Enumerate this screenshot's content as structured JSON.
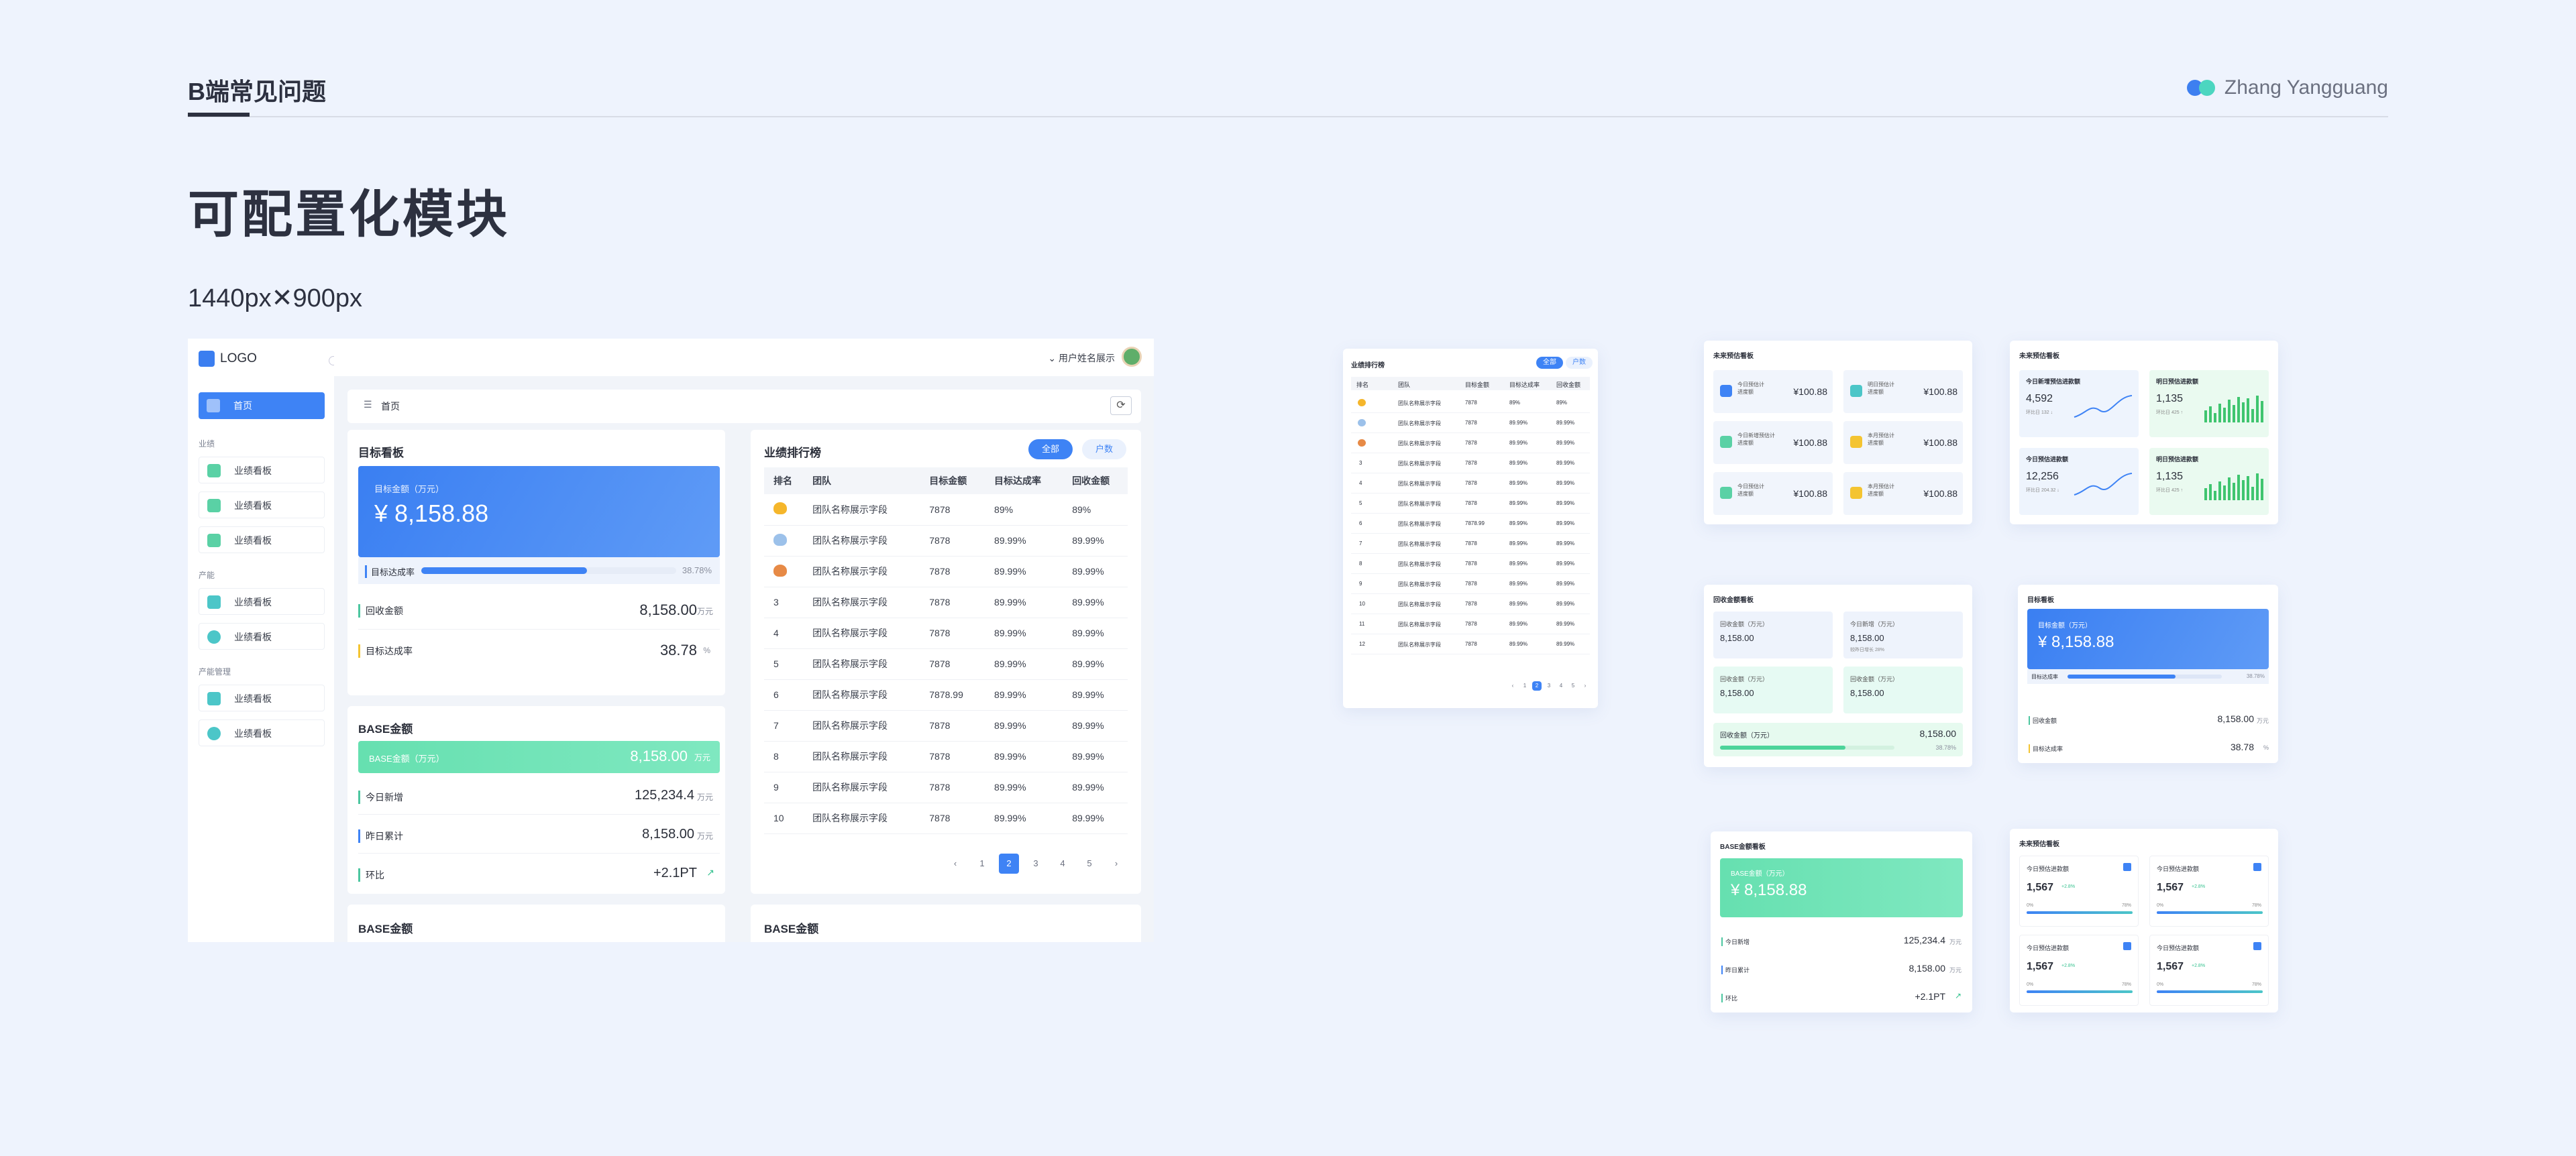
{
  "header": {
    "section": "B端常见问题",
    "author": "Zhang Yangguang",
    "colors": {
      "dot1": "#3d7ff0",
      "dot2": "#4cd6c0"
    }
  },
  "title": "可配置化模块",
  "size_label": "1440px✕900px",
  "mock": {
    "logo": "LOGO",
    "user": "用户姓名展示",
    "breadcrumb": "首页",
    "sidebar": {
      "home": "首页",
      "groups": [
        "业绩",
        "产能",
        "产能管理"
      ],
      "item": "业绩看板"
    },
    "target": {
      "title": "目标看板",
      "card_label": "目标金额（万元）",
      "card_value": "¥ 8,158.88",
      "progress_label": "目标达成率",
      "progress_pct": "38.78%",
      "progress": 0.3878,
      "rows": [
        {
          "label": "回收金额",
          "value": "8,158.00",
          "unit": "万元"
        },
        {
          "label": "目标达成率",
          "value": "38.78",
          "unit": "%"
        }
      ]
    },
    "base": {
      "title": "BASE金额",
      "card_label": "BASE金额（万元）",
      "card_value": "8,158.00",
      "card_unit": "万元",
      "rows": [
        {
          "label": "今日新增",
          "value": "125,234.4",
          "unit": "万元"
        },
        {
          "label": "昨日累计",
          "value": "8,158.00",
          "unit": "万元"
        },
        {
          "label": "环比",
          "value": "+2.1PT",
          "unit": ""
        }
      ]
    },
    "rank": {
      "title": "业绩排行榜",
      "tab_all": "全部",
      "tab_user": "户数",
      "columns": [
        "排名",
        "团队",
        "目标金额",
        "目标达成率",
        "回收金额"
      ],
      "rows": [
        [
          "",
          "团队名称展示字段",
          "7878",
          "89%",
          "89%"
        ],
        [
          "",
          "团队名称展示字段",
          "7878",
          "89.99%",
          "89.99%"
        ],
        [
          "",
          "团队名称展示字段",
          "7878",
          "89.99%",
          "89.99%"
        ],
        [
          "3",
          "团队名称展示字段",
          "7878",
          "89.99%",
          "89.99%"
        ],
        [
          "4",
          "团队名称展示字段",
          "7878",
          "89.99%",
          "89.99%"
        ],
        [
          "5",
          "团队名称展示字段",
          "7878",
          "89.99%",
          "89.99%"
        ],
        [
          "6",
          "团队名称展示字段",
          "7878.99",
          "89.99%",
          "89.99%"
        ],
        [
          "7",
          "团队名称展示字段",
          "7878",
          "89.99%",
          "89.99%"
        ],
        [
          "8",
          "团队名称展示字段",
          "7878",
          "89.99%",
          "89.99%"
        ],
        [
          "9",
          "团队名称展示字段",
          "7878",
          "89.99%",
          "89.99%"
        ],
        [
          "10",
          "团队名称展示字段",
          "7878",
          "89.99%",
          "89.99%"
        ]
      ],
      "pages": [
        "‹",
        "1",
        "2",
        "3",
        "4",
        "5",
        "›"
      ],
      "current": "2"
    },
    "bottom_left": "BASE金额",
    "bottom_right": "BASE金额"
  },
  "thumbs": {
    "rank_small": {
      "title": "业绩排行榜",
      "tab_all": "全部",
      "tab_user": "户数",
      "columns": [
        "排名",
        "团队",
        "目标金额",
        "目标达成率",
        "回收金额"
      ],
      "row_team": "团队名称展示字段",
      "pages": [
        "‹",
        "1",
        "2",
        "3",
        "4",
        "5",
        "›"
      ]
    },
    "forecast1": {
      "title": "未来预估看板",
      "items": [
        {
          "label": "今日预估计\n进度额",
          "value": "¥100.88"
        },
        {
          "label": "明日预估计\n进度额",
          "value": "¥100.88"
        },
        {
          "label": "今日新增预估计\n进度额",
          "value": "¥100.88"
        },
        {
          "label": "本月预估计\n进度额",
          "value": "¥100.88"
        },
        {
          "label": "今日预估计\n进度额",
          "value": "¥100.88"
        },
        {
          "label": "本月预估计\n进度额",
          "value": "¥100.88"
        }
      ]
    },
    "forecast2": {
      "title": "未来预估看板",
      "items": [
        {
          "label": "今日新增预估进款额",
          "value": "4,592",
          "sub": "环比日 132 ↓"
        },
        {
          "label": "明日预估进款额",
          "value": "1,135",
          "sub": "环比日 425 ↑"
        },
        {
          "label": "今日预估进款额",
          "value": "12,256",
          "sub": "环比日 204.32 ↓"
        },
        {
          "label": "明日预估进款额",
          "value": "1,135",
          "sub": "环比日 425 ↑"
        }
      ]
    },
    "recovery": {
      "title": "回收金额看板",
      "items": [
        {
          "label": "回收金额（万元）",
          "value": "8,158.00"
        },
        {
          "label": "今日新增（万元）",
          "value": "8,158.00",
          "sub": "较昨日增长 28%"
        },
        {
          "label": "回收金额（万元）",
          "value": "8,158.00"
        },
        {
          "label": "回收金额（万元）",
          "value": "8,158.00"
        }
      ],
      "bar_label": "回收金额（万元）",
      "bar_value": "8,158.00",
      "bar_pct": "38.78%"
    },
    "target_small": {
      "title": "目标看板",
      "card_label": "目标金额（万元）",
      "card_value": "¥ 8,158.88",
      "progress_label": "目标达成率",
      "progress_pct": "38.78%",
      "rows": [
        {
          "label": "回收金额",
          "value": "8,158.00",
          "unit": "万元"
        },
        {
          "label": "目标达成率",
          "value": "38.78",
          "unit": "%"
        }
      ]
    },
    "base_small": {
      "title": "BASE金额看板",
      "card_label": "BASE金额（万元）",
      "card_value": "¥ 8,158.88",
      "rows": [
        {
          "label": "今日新增",
          "value": "125,234.4",
          "unit": "万元"
        },
        {
          "label": "昨日累计",
          "value": "8,158.00",
          "unit": "万元"
        },
        {
          "label": "环比",
          "value": "+2.1PT",
          "unit": ""
        }
      ]
    },
    "forecast3": {
      "title": "未来预估看板",
      "item_label": "今日预估进款额",
      "value": "1,567",
      "delta": "+2.8%",
      "min": "0%",
      "max": "78%"
    }
  }
}
